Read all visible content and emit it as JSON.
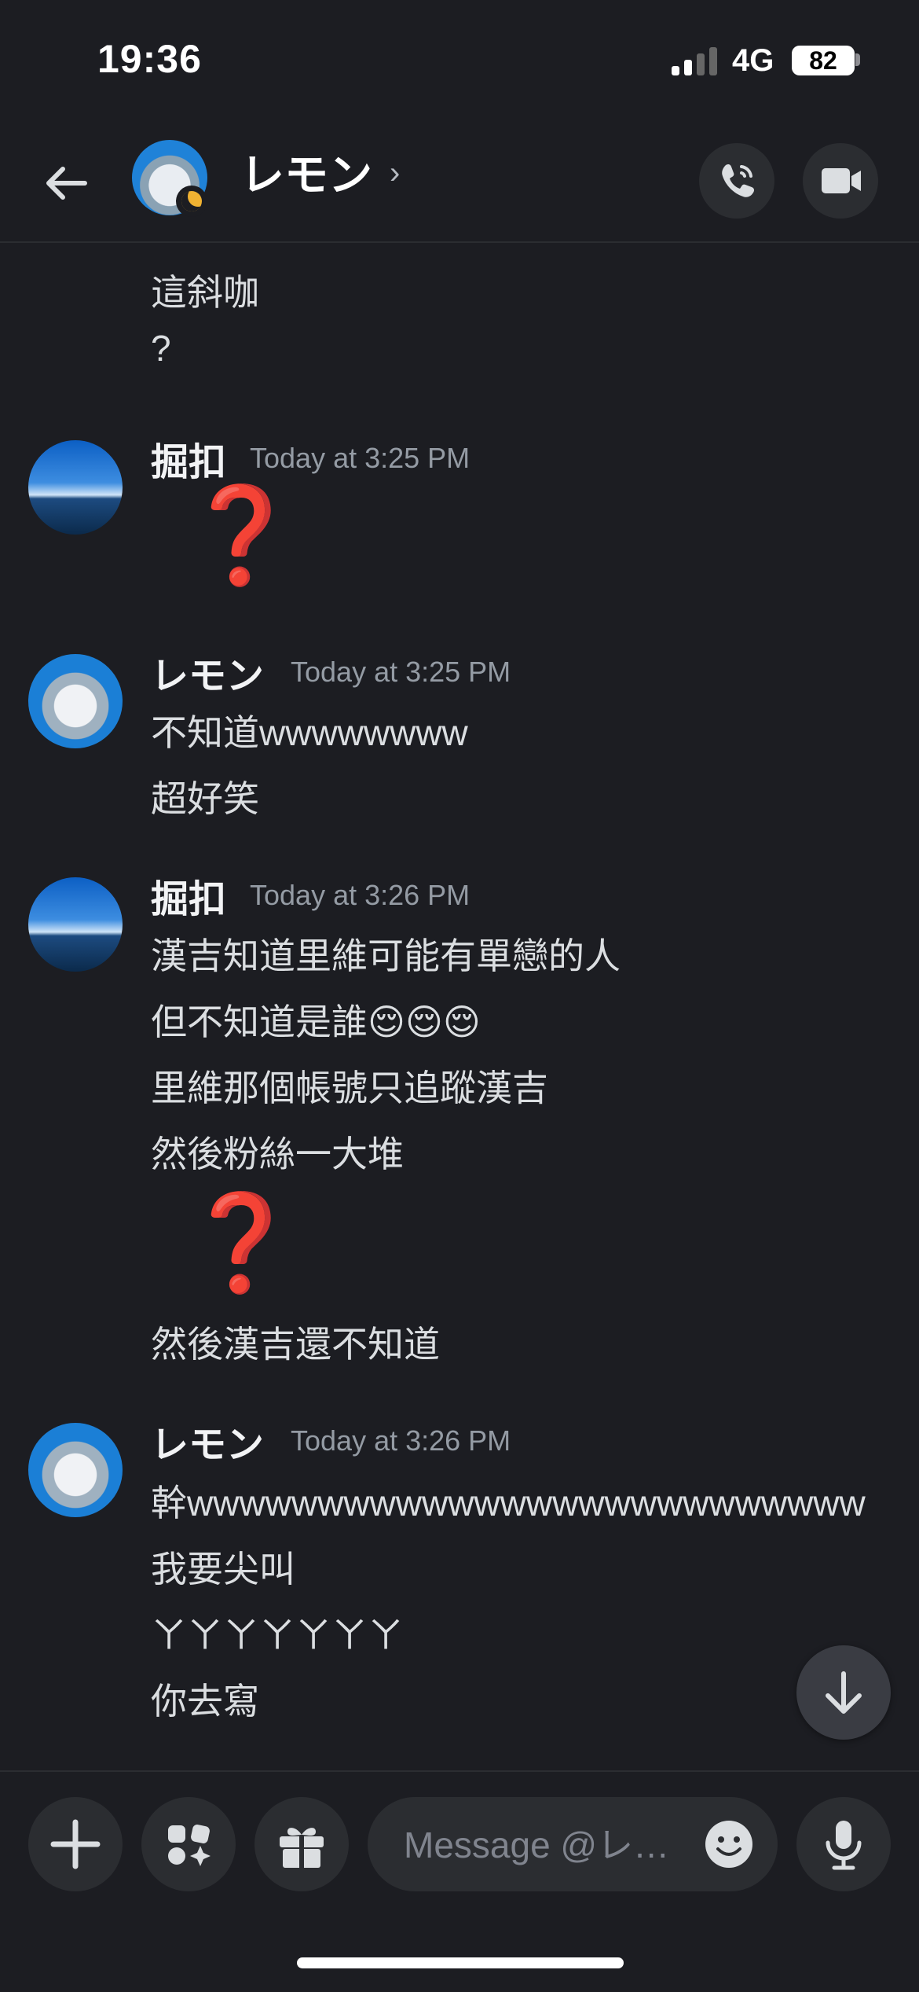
{
  "status_bar": {
    "time": "19:36",
    "network": "4G",
    "battery": "82"
  },
  "header": {
    "name": "レモン",
    "chevron": "›"
  },
  "messages": {
    "top_lines": [
      "這斜咖",
      "?"
    ],
    "groups": [
      {
        "author": "掘扣",
        "timestamp": "Today at 3:25 PM",
        "lines": [
          "❓"
        ]
      },
      {
        "author": "レモン",
        "timestamp": "Today at 3:25 PM",
        "lines": [
          "不知道wwwwwwww",
          "超好笑"
        ]
      },
      {
        "author": "掘扣",
        "timestamp": "Today at 3:26 PM",
        "lines": [
          "漢吉知道里維可能有單戀的人",
          "但不知道是誰😌😌😌",
          "里維那個帳號只追蹤漢吉",
          "然後粉絲一大堆",
          "❓",
          "然後漢吉還不知道"
        ]
      },
      {
        "author": "レモン",
        "timestamp": "Today at 3:26 PM",
        "lines": [
          "幹wwwwwwwwwwwwwwwwwwwwwwwwww",
          "我要尖叫",
          "ㄚㄚㄚㄚㄚㄚㄚ",
          "你去寫"
        ]
      }
    ]
  },
  "composer": {
    "placeholder": "Message @レ…"
  },
  "icons": {
    "back": "arrow-left-icon",
    "call": "phone-icon",
    "video": "video-camera-icon",
    "plus": "plus-icon",
    "apps": "apps-icon",
    "gift": "gift-icon",
    "emoji": "emoji-icon",
    "mic": "microphone-icon",
    "jump": "arrow-down-icon"
  },
  "colors": {
    "background": "#1c1d22",
    "surface": "#2b2d31",
    "timestamp": "#949ba4",
    "idle": "#f0b232",
    "question_mark": "#dd1f1f"
  }
}
